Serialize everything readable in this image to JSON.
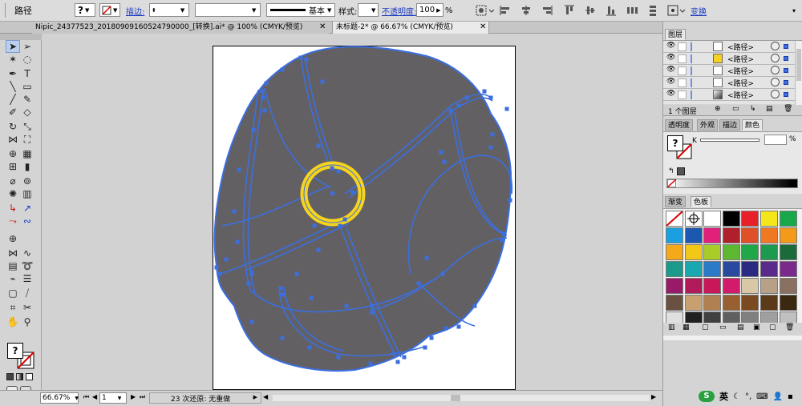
{
  "control": {
    "object_type": "路径",
    "stroke_label": "描边:",
    "stroke_profile": "基本",
    "style_label": "样式:",
    "opacity_label": "不透明度:",
    "opacity_value": "100",
    "opacity_unit": "%",
    "transform_label": "变换"
  },
  "tabs": [
    {
      "label": "Nipic_24377523_20180909160524790000_[转换].ai* @ 100% (CMYK/预览)"
    },
    {
      "label": "未标题-2* @ 66.67% (CMYK/预览)"
    }
  ],
  "status": {
    "zoom": "66.67%",
    "page": "1",
    "info": "23 次还原: 无重做"
  },
  "layers": {
    "title": "图层",
    "rows": [
      {
        "name": "<路径>"
      },
      {
        "name": "<路径>"
      },
      {
        "name": "<路径>"
      },
      {
        "name": "<路径>"
      },
      {
        "name": "<路径>"
      }
    ],
    "count": "1 个图层"
  },
  "mid_tabs": [
    {
      "label": "透明度"
    },
    {
      "label": "外观"
    },
    {
      "label": "描边"
    },
    {
      "label": "颜色"
    }
  ],
  "color": {
    "channel": "K",
    "value": "",
    "unit": "%"
  },
  "bottom_tabs": [
    {
      "label": "渐变"
    },
    {
      "label": "色板"
    }
  ],
  "colors": {
    "shape_fill": "#636063",
    "path_stroke": "#3b6fe0",
    "ring": "#f6d31c",
    "link_blue": "#1d3bc2"
  },
  "swatches": [
    "none",
    "registration",
    "#ffffff",
    "#000000",
    "#e8202a",
    "#f4e61a",
    "#18a84a",
    "#1aa0e0",
    "#1c57b0",
    "#e0207a",
    "#b0202a",
    "#e05028",
    "#f07820",
    "#f49a1a",
    "#f4a81a",
    "#f2c818",
    "#a8cc28",
    "#5cb830",
    "#20a848",
    "#1e9a50",
    "#1a6a3a",
    "#1a9a8a",
    "#1aa8b0",
    "#2a7ac8",
    "#2a4aa0",
    "#2a2a80",
    "#5a2a8a",
    "#7a2a8a",
    "#9a1a6a",
    "#b01a5a",
    "#c8185a",
    "#d41a6a",
    "#d8c8a8",
    "#b8a088",
    "#8a7060",
    "#6a5040",
    "#c8a070",
    "#b08050",
    "#986030",
    "#7a4a20",
    "#5a3a18",
    "#3a2810",
    "#e0e0e0",
    "#202020",
    "#404040",
    "#606060",
    "#808080",
    "#a0a0a0",
    "#c0c0c0"
  ]
}
